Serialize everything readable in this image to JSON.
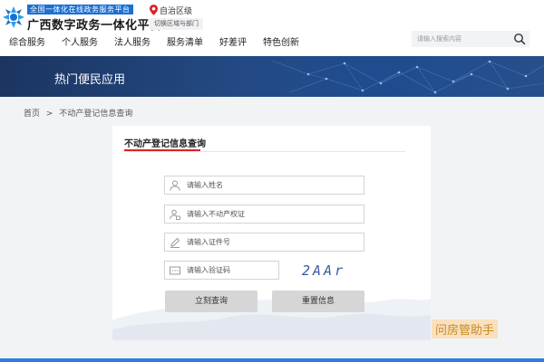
{
  "header": {
    "logo_tagline": "全国一体化在线政务服务平台",
    "logo_title": "广西数字政务一体化平台",
    "region_name": "自治区级",
    "region_switch": "切换区域与部门"
  },
  "nav": {
    "items": [
      "综合服务",
      "个人服务",
      "法人服务",
      "服务清单",
      "好差评",
      "特色创新"
    ]
  },
  "search": {
    "placeholder": "请输入搜索内容"
  },
  "banner": {
    "title": "热门便民应用"
  },
  "breadcrumb": {
    "home": "首页",
    "separator": ">",
    "current": "不动产登记信息查询"
  },
  "form": {
    "title": "不动产登记信息查询",
    "name_placeholder": "请输入姓名",
    "cert_placeholder": "请输入不动产权证",
    "id_placeholder": "请输入证件号",
    "captcha_placeholder": "请输入验证码",
    "captcha_value": "2AAr",
    "submit_label": "立刻查询",
    "reset_label": "重置信息"
  },
  "watermark": {
    "text": "问房管助手"
  },
  "colors": {
    "accent_blue": "#1d6fd1",
    "title_underline": "#d9222a",
    "banner_dark": "#1b3560",
    "bottom_bar": "#2f7fe0"
  },
  "icons": {
    "logo": "gov-logo-icon",
    "location": "location-pin-icon",
    "search": "search-icon",
    "name_field": "user-icon",
    "cert_field": "certificate-user-icon",
    "id_field": "pen-icon",
    "captcha_field": "captcha-icon"
  }
}
